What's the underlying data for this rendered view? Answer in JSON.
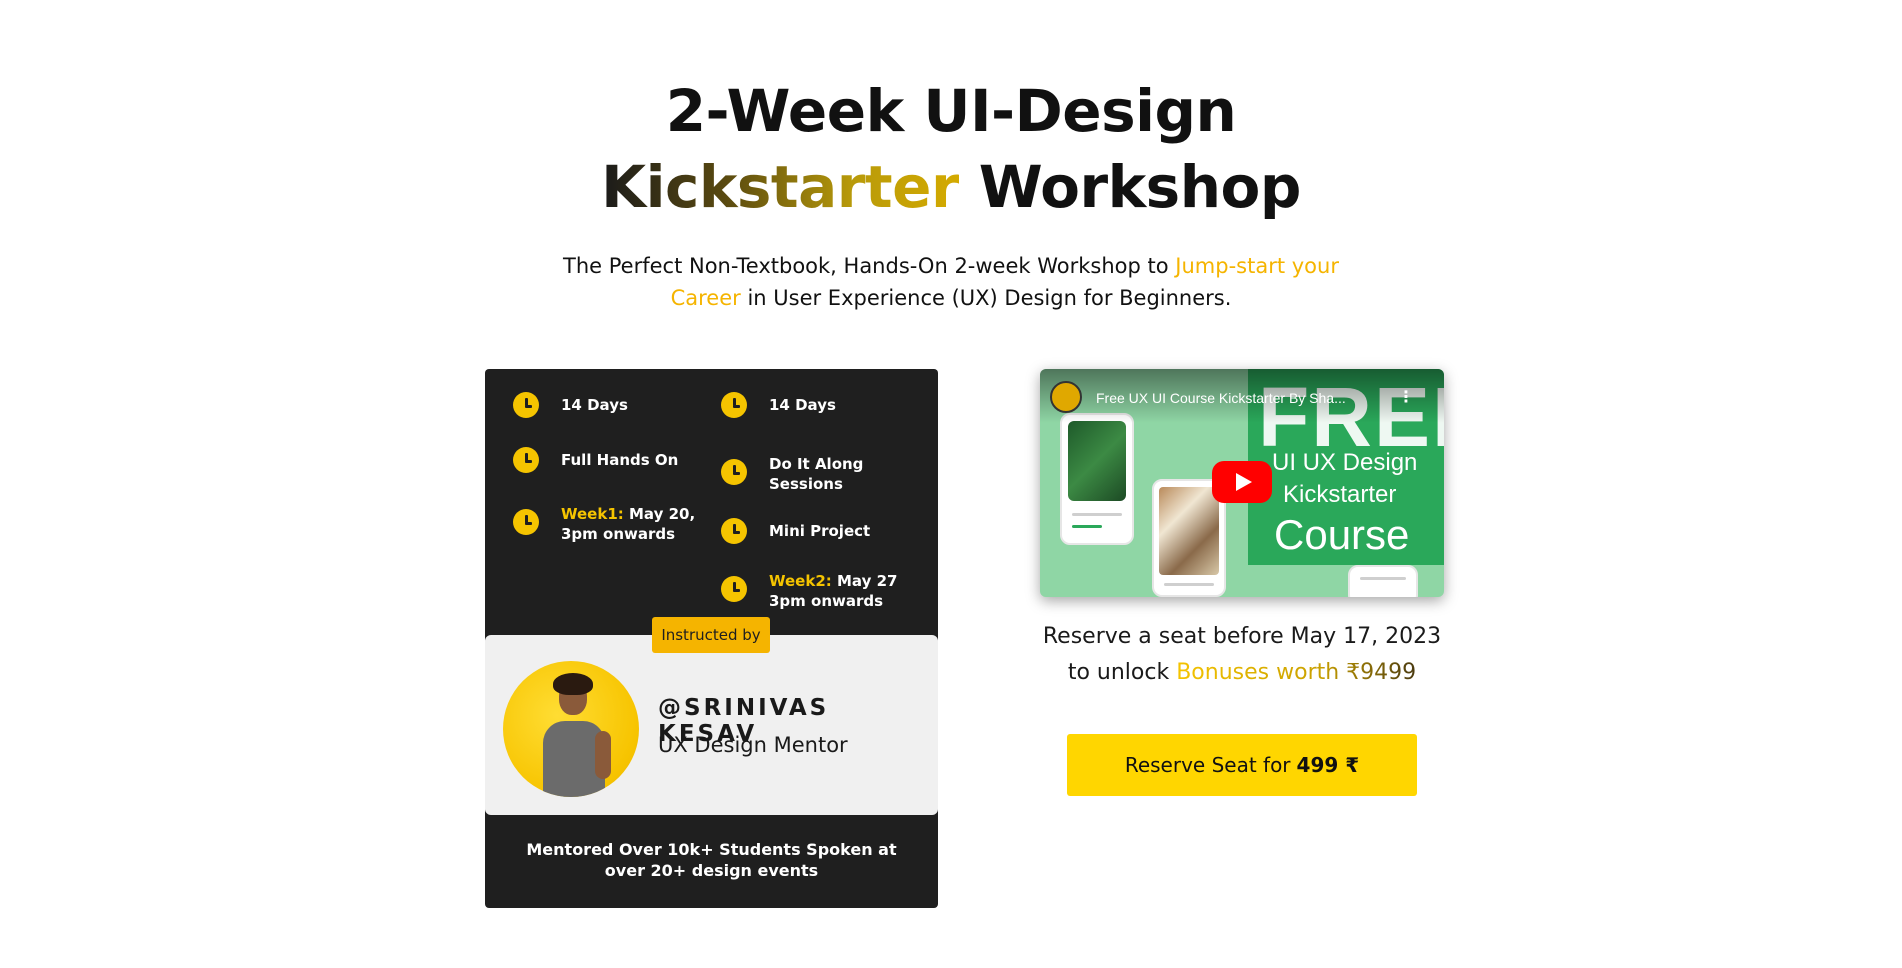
{
  "hero": {
    "line1": "2-Week UI-Design",
    "highlight": "Kickstarter",
    "line2_rest": " Workshop"
  },
  "subtitle": {
    "part1": "The Perfect Non-Textbook, Hands-On 2-week Workshop to ",
    "highlight": "Jump-start your Career",
    "part2": " in User Experience (UX) Design for Beginners."
  },
  "card": {
    "features": [
      {
        "text": "14 Days"
      },
      {
        "text": "14 Days"
      },
      {
        "text": "Full Hands On"
      },
      {
        "text": "Do It Along Sessions"
      },
      {
        "week": "Week1:",
        "text": " May 20, 3pm onwards"
      },
      {
        "text": "Mini Project"
      },
      {
        "week": "Week2:",
        "text": " May 27 3pm onwards"
      }
    ],
    "badge": "Instructed by",
    "instructor_name": "@SRINIVAS KESAV",
    "instructor_role": "UX Design Mentor",
    "footer": "Mentored Over 10k+ Students Spoken at over 20+ design events"
  },
  "video": {
    "title": "Free UX UI Course Kickstarter By Sha...",
    "thumb_big": "FREE",
    "thumb_l1": "UI UX Design",
    "thumb_l2": "Kickstarter",
    "thumb_l3": "Course"
  },
  "reserve": {
    "line1": "Reserve a seat before May 17, 2023",
    "line2_prefix": "to unlock ",
    "bonus": "Bonuses worth ₹9499",
    "cta_label": "Reserve Seat for",
    "cta_price": "499 ₹"
  },
  "colors": {
    "accent": "#f5c400",
    "card_bg": "#1f1f1f",
    "cta_bg": "#ffd600"
  }
}
